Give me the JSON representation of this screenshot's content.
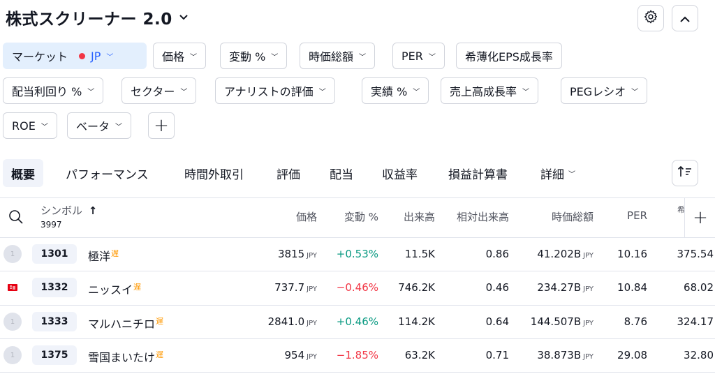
{
  "header": {
    "title": "株式スクリーナー 2.0"
  },
  "filters": {
    "market_label": "マーケット",
    "market_value": "JP",
    "chips": [
      "価格",
      "変動 %",
      "時価総額",
      "PER",
      "希薄化EPS成長率",
      "配当利回り %",
      "セクター",
      "アナリストの評価",
      "実績 %",
      "売上高成長率",
      "PEGレシオ",
      "ROE",
      "ベータ"
    ]
  },
  "tabs": [
    "概要",
    "パフォーマンス",
    "時間外取引",
    "評価",
    "配当",
    "収益率",
    "損益計算書",
    "詳細"
  ],
  "table": {
    "symbol_header": "シンボル",
    "symbol_count": "3997",
    "sort_arrow": "↑",
    "columns": [
      "価格",
      "変動 %",
      "出来高",
      "相対出来高",
      "時価総額",
      "PER",
      "希"
    ],
    "rows": [
      {
        "logo": "1",
        "ticker": "1301",
        "name": "極洋",
        "delay": "遅",
        "price": "3815",
        "price_unit": "JPY",
        "change": "+0.53%",
        "change_dir": "up",
        "volume": "11.5K",
        "rel_volume": "0.86",
        "market_cap": "41.202B",
        "cap_unit": "JPY",
        "per": "10.16",
        "next": "375.54"
      },
      {
        "logo": "",
        "ticker": "1332",
        "name": "ニッスイ",
        "delay": "遅",
        "price": "737.7",
        "price_unit": "JPY",
        "change": "−0.46%",
        "change_dir": "down",
        "volume": "746.2K",
        "rel_volume": "0.46",
        "market_cap": "234.27B",
        "cap_unit": "JPY",
        "per": "10.84",
        "next": "68.02"
      },
      {
        "logo": "1",
        "ticker": "1333",
        "name": "マルハニチロ",
        "delay": "遅",
        "price": "2841.0",
        "price_unit": "JPY",
        "change": "+0.46%",
        "change_dir": "up",
        "volume": "114.2K",
        "rel_volume": "0.64",
        "market_cap": "144.507B",
        "cap_unit": "JPY",
        "per": "8.76",
        "next": "324.17"
      },
      {
        "logo": "1",
        "ticker": "1375",
        "name": "雪国まいたけ",
        "delay": "遅",
        "price": "954",
        "price_unit": "JPY",
        "change": "−1.85%",
        "change_dir": "down",
        "volume": "63.2K",
        "rel_volume": "0.71",
        "market_cap": "38.873B",
        "cap_unit": "JPY",
        "per": "29.08",
        "next": "32.80"
      }
    ]
  },
  "colors": {
    "up": "#089981",
    "down": "#f23645",
    "accent": "#2962ff",
    "delay": "#ff9800"
  }
}
